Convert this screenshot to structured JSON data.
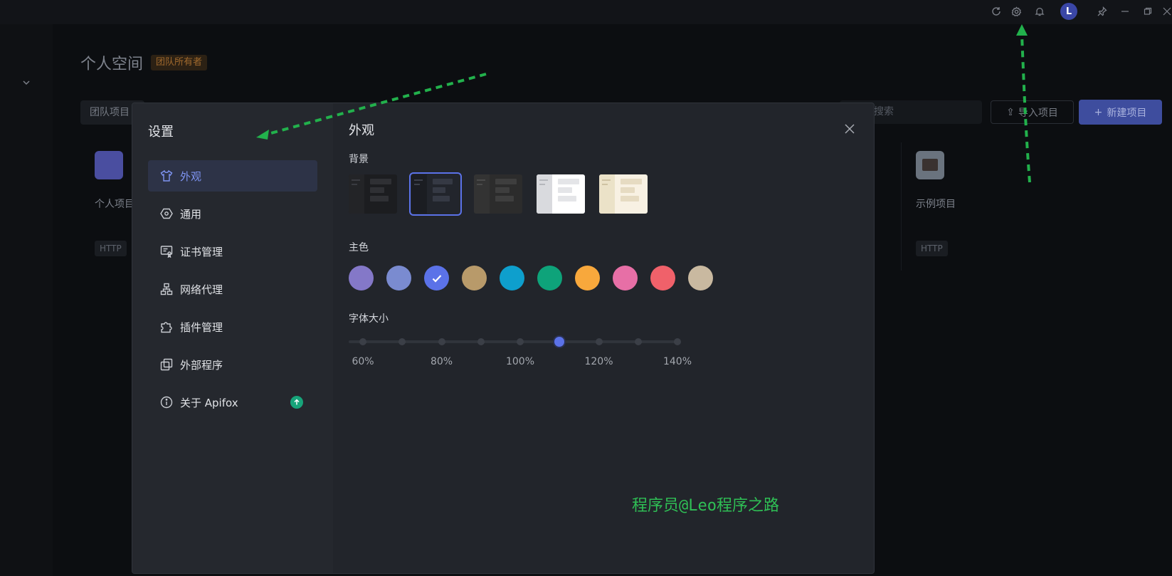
{
  "app": {
    "workspace_title": "个人空间",
    "owner_badge": "团队所有者",
    "team_tab": "团队项目",
    "search_placeholder": "搜索",
    "import_label": "导入项目",
    "new_label": "新建项目",
    "avatar_letter": "L",
    "projects": [
      {
        "name": "个人项目",
        "tag": "HTTP"
      },
      {
        "name": "示例项目",
        "tag": "HTTP"
      }
    ]
  },
  "settings": {
    "title": "设置",
    "menu": [
      {
        "label": "外观",
        "icon": "shirt-icon",
        "active": true
      },
      {
        "label": "通用",
        "icon": "hexagon-icon"
      },
      {
        "label": "证书管理",
        "icon": "certificate-icon"
      },
      {
        "label": "网络代理",
        "icon": "network-icon"
      },
      {
        "label": "插件管理",
        "icon": "puzzle-icon"
      },
      {
        "label": "外部程序",
        "icon": "external-icon"
      },
      {
        "label": "关于 Apifox",
        "icon": "info-icon",
        "badge": "update-icon"
      }
    ],
    "section_title": "外观",
    "background_label": "背景",
    "background_themes": [
      {
        "name": "dark",
        "selected": false
      },
      {
        "name": "dark-blue",
        "selected": true
      },
      {
        "name": "dark-gray",
        "selected": false
      },
      {
        "name": "light",
        "selected": false
      },
      {
        "name": "warm",
        "selected": false
      }
    ],
    "primary_color_label": "主色",
    "primary_colors": [
      "#8478c8",
      "#7a8bd0",
      "#5b72e8",
      "#b89a6a",
      "#0e9fcd",
      "#0ea37a",
      "#f8a83c",
      "#e76fa6",
      "#f0616a",
      "#c9b9a0"
    ],
    "selected_color": "#5b72e8",
    "font_size_label": "字体大小",
    "font_size_ticks": [
      "60%",
      "80%",
      "100%",
      "120%",
      "140%"
    ],
    "font_size_value_percent": 110
  },
  "watermark": "程序员@Leo程序之路"
}
